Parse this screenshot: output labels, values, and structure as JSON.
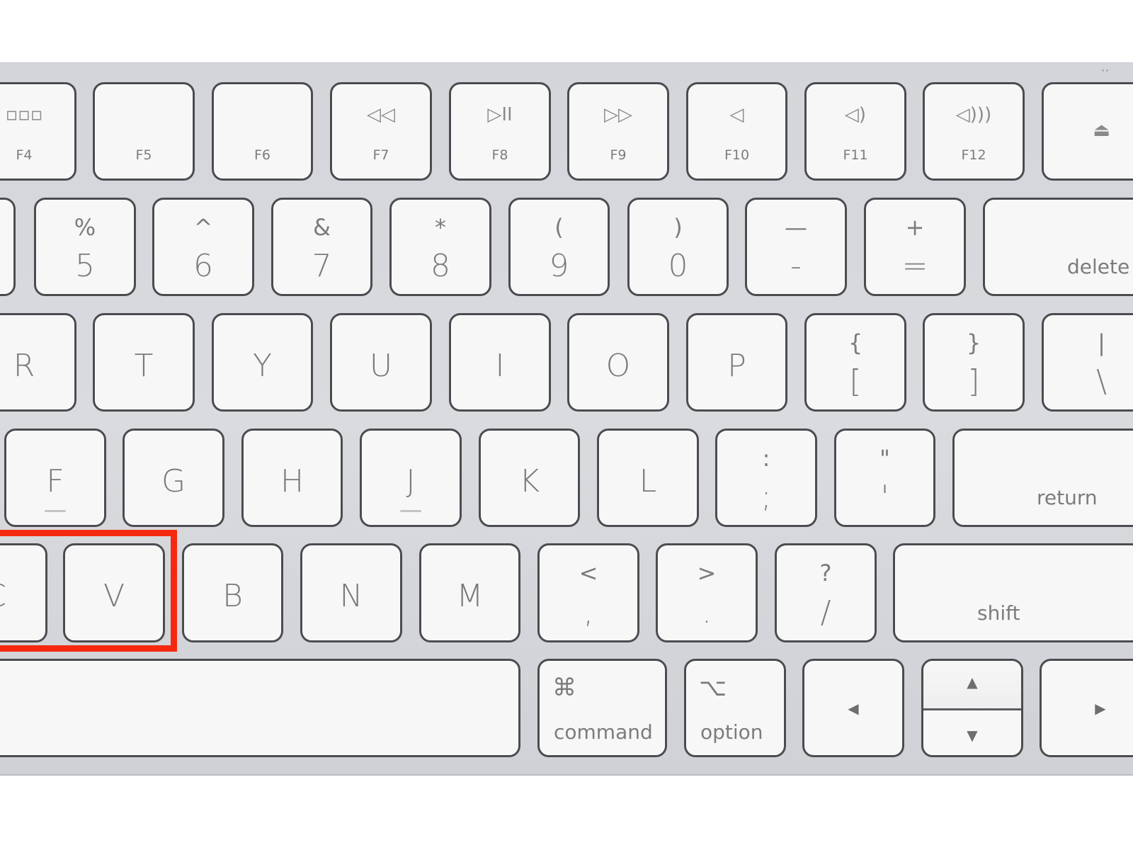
{
  "image": {
    "subject": "Apple Magic Keyboard (partial view)",
    "highlight": {
      "target_keys": [
        "C",
        "V"
      ],
      "color": "#f5290f"
    },
    "colors": {
      "key_face": "#f7f7f7",
      "key_border": "#4a4c50",
      "chassis": "#d6d8dc",
      "legend": "#7c7c7c"
    }
  },
  "rows": {
    "function": [
      {
        "id": "f4",
        "label": "F4",
        "icon": "launchpad-icon",
        "glyph": "▫▫▫"
      },
      {
        "id": "f5",
        "label": "F5",
        "icon": "",
        "glyph": ""
      },
      {
        "id": "f6",
        "label": "F6",
        "icon": "",
        "glyph": ""
      },
      {
        "id": "f7",
        "label": "F7",
        "icon": "rewind-icon",
        "glyph": "◁◁"
      },
      {
        "id": "f8",
        "label": "F8",
        "icon": "play-pause-icon",
        "glyph": "▷II"
      },
      {
        "id": "f9",
        "label": "F9",
        "icon": "fast-forward-icon",
        "glyph": "▷▷"
      },
      {
        "id": "f10",
        "label": "F10",
        "icon": "mute-icon",
        "glyph": "◁"
      },
      {
        "id": "f11",
        "label": "F11",
        "icon": "volume-down-icon",
        "glyph": "◁)"
      },
      {
        "id": "f12",
        "label": "F12",
        "icon": "volume-up-icon",
        "glyph": "◁)))"
      },
      {
        "id": "eject",
        "label": "",
        "icon": "eject-icon",
        "glyph": "⏏"
      }
    ],
    "number": [
      {
        "id": "4-partial",
        "top": "",
        "main": ""
      },
      {
        "id": "5",
        "top": "%",
        "main": "5"
      },
      {
        "id": "6",
        "top": "^",
        "main": "6"
      },
      {
        "id": "7",
        "top": "&",
        "main": "7"
      },
      {
        "id": "8",
        "top": "*",
        "main": "8"
      },
      {
        "id": "9",
        "top": "(",
        "main": "9"
      },
      {
        "id": "0",
        "top": ")",
        "main": "0"
      },
      {
        "id": "minus",
        "top": "—",
        "main": "-"
      },
      {
        "id": "equals",
        "top": "+",
        "main": "="
      },
      {
        "id": "delete",
        "word": "delete"
      }
    ],
    "top_letters": [
      {
        "id": "r",
        "main": "R"
      },
      {
        "id": "t",
        "main": "T"
      },
      {
        "id": "y",
        "main": "Y"
      },
      {
        "id": "u",
        "main": "U"
      },
      {
        "id": "i",
        "main": "I"
      },
      {
        "id": "o",
        "main": "O"
      },
      {
        "id": "p",
        "main": "P"
      },
      {
        "id": "open-bracket",
        "top": "{",
        "main": "["
      },
      {
        "id": "close-bracket",
        "top": "}",
        "main": "]"
      },
      {
        "id": "backslash",
        "top": "|",
        "main": "\\"
      }
    ],
    "home_letters": [
      {
        "id": "f",
        "main": "F",
        "bump": true
      },
      {
        "id": "g",
        "main": "G"
      },
      {
        "id": "h",
        "main": "H"
      },
      {
        "id": "j",
        "main": "J",
        "bump": true
      },
      {
        "id": "k",
        "main": "K"
      },
      {
        "id": "l",
        "main": "L"
      },
      {
        "id": "semicolon",
        "top": ":",
        "main": ";"
      },
      {
        "id": "quote",
        "top": "\"",
        "main": "'"
      },
      {
        "id": "return",
        "word": "return"
      }
    ],
    "bottom_letters": [
      {
        "id": "c",
        "main": "C"
      },
      {
        "id": "v",
        "main": "V"
      },
      {
        "id": "b",
        "main": "B"
      },
      {
        "id": "n",
        "main": "N"
      },
      {
        "id": "m",
        "main": "M"
      },
      {
        "id": "comma",
        "top": "<",
        "main": ","
      },
      {
        "id": "period",
        "top": ">",
        "main": "."
      },
      {
        "id": "slash",
        "top": "?",
        "main": "/"
      },
      {
        "id": "shift",
        "word": "shift"
      }
    ],
    "modifiers": [
      {
        "id": "space",
        "word": ""
      },
      {
        "id": "command",
        "glyph": "⌘",
        "word": "command"
      },
      {
        "id": "option",
        "glyph": "⌥",
        "word": "option"
      },
      {
        "id": "left-arrow",
        "arrow": "◀"
      },
      {
        "id": "up-down-arrows",
        "up": "▲",
        "down": "▼"
      },
      {
        "id": "right-arrow",
        "arrow": "▶"
      }
    ]
  }
}
